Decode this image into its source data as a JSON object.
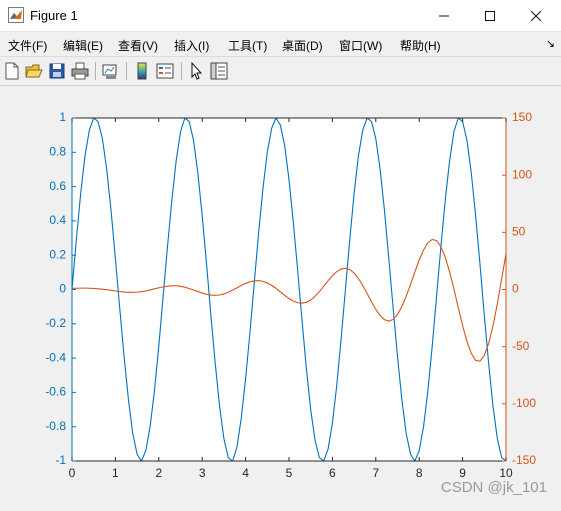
{
  "window": {
    "title": "Figure 1"
  },
  "menu": [
    "文件(F)",
    "编辑(E)",
    "查看(V)",
    "插入(I)",
    "工具(T)",
    "桌面(D)",
    "窗口(W)",
    "帮助(H)"
  ],
  "toolbar": [
    "new-figure",
    "open-file",
    "save",
    "print",
    "link-plot",
    "colorbar",
    "legend",
    "edit-plot",
    "property-inspector"
  ],
  "watermark": "CSDN @jk_101",
  "colors": {
    "left_axis": "#0072bd",
    "right_axis": "#d95319"
  },
  "chart_data": {
    "type": "line",
    "xlim": [
      0,
      10
    ],
    "xticks": [
      "0",
      "1",
      "2",
      "3",
      "4",
      "5",
      "6",
      "7",
      "8",
      "9",
      "10"
    ],
    "yyaxis": true,
    "left": {
      "ylim": [
        -1,
        1
      ],
      "yticks": [
        "-1",
        "-0.8",
        "-0.6",
        "-0.4",
        "-0.2",
        "0",
        "0.2",
        "0.4",
        "0.6",
        "0.8",
        "1"
      ],
      "series": [
        {
          "x": [
            0,
            0.1,
            0.2,
            0.3,
            0.4,
            0.5,
            0.6,
            0.7,
            0.8,
            0.9,
            1,
            1.1,
            1.2,
            1.3,
            1.4,
            1.5,
            1.6,
            1.7,
            1.8,
            1.9,
            2,
            2.1,
            2.2,
            2.3,
            2.4,
            2.5,
            2.6,
            2.7,
            2.8,
            2.9,
            3,
            3.1,
            3.2,
            3.3,
            3.4,
            3.5,
            3.6,
            3.7,
            3.8,
            3.9,
            4,
            4.1,
            4.2,
            4.3,
            4.4,
            4.5,
            4.6,
            4.7,
            4.8,
            4.9,
            5,
            5.1,
            5.2,
            5.3,
            5.4,
            5.5,
            5.6,
            5.7,
            5.8,
            5.9,
            6,
            6.1,
            6.2,
            6.3,
            6.4,
            6.5,
            6.6,
            6.7,
            6.8,
            6.9,
            7,
            7.1,
            7.2,
            7.3,
            7.4,
            7.5,
            7.6,
            7.7,
            7.8,
            7.9,
            8,
            8.1,
            8.2,
            8.3,
            8.4,
            8.5,
            8.6,
            8.7,
            8.8,
            8.9,
            9,
            9.1,
            9.2,
            9.3,
            9.4,
            9.5,
            9.6,
            9.7,
            9.8,
            9.9,
            10
          ],
          "y": [
            0,
            0.29,
            0.56,
            0.78,
            0.93,
            1,
            0.98,
            0.88,
            0.7,
            0.46,
            0.18,
            -0.11,
            -0.39,
            -0.64,
            -0.84,
            -0.96,
            -1,
            -0.94,
            -0.8,
            -0.59,
            -0.33,
            -0.04,
            0.25,
            0.52,
            0.75,
            0.92,
            1,
            0.98,
            0.87,
            0.68,
            0.43,
            0.15,
            -0.15,
            -0.43,
            -0.68,
            -0.87,
            -0.98,
            -1,
            -0.92,
            -0.75,
            -0.52,
            -0.25,
            0.04,
            0.33,
            0.59,
            0.8,
            0.94,
            1,
            0.96,
            0.84,
            0.64,
            0.39,
            0.11,
            -0.18,
            -0.46,
            -0.7,
            -0.88,
            -0.98,
            -1,
            -0.93,
            -0.78,
            -0.56,
            -0.29,
            0,
            0.29,
            0.56,
            0.78,
            0.93,
            1,
            0.98,
            0.88,
            0.7,
            0.46,
            0.18,
            -0.11,
            -0.39,
            -0.64,
            -0.84,
            -0.96,
            -1,
            -0.94,
            -0.8,
            -0.59,
            -0.33,
            -0.04,
            0.25,
            0.52,
            0.75,
            0.92,
            1,
            0.98,
            0.87,
            0.68,
            0.43,
            0.15,
            -0.15,
            -0.43,
            -0.68,
            -0.87,
            -0.98,
            -1
          ]
        }
      ]
    },
    "right": {
      "ylim": [
        -150,
        150
      ],
      "yticks": [
        "-150",
        "-100",
        "-50",
        "0",
        "50",
        "100",
        "150"
      ],
      "series": [
        {
          "x": [
            0,
            0.1,
            0.2,
            0.3,
            0.4,
            0.5,
            0.6,
            0.7,
            0.8,
            0.9,
            1,
            1.1,
            1.2,
            1.3,
            1.4,
            1.5,
            1.6,
            1.7,
            1.8,
            1.9,
            2,
            2.1,
            2.2,
            2.3,
            2.4,
            2.5,
            2.6,
            2.7,
            2.8,
            2.9,
            3,
            3.1,
            3.2,
            3.3,
            3.4,
            3.5,
            3.6,
            3.7,
            3.8,
            3.9,
            4,
            4.1,
            4.2,
            4.3,
            4.4,
            4.5,
            4.6,
            4.7,
            4.8,
            4.9,
            5,
            5.1,
            5.2,
            5.3,
            5.4,
            5.5,
            5.6,
            5.7,
            5.8,
            5.9,
            6,
            6.1,
            6.2,
            6.3,
            6.4,
            6.5,
            6.6,
            6.7,
            6.8,
            6.9,
            7,
            7.1,
            7.2,
            7.3,
            7.4,
            7.5,
            7.6,
            7.7,
            7.8,
            7.9,
            8,
            8.1,
            8.2,
            8.3,
            8.4,
            8.5,
            8.6,
            8.7,
            8.8,
            8.9,
            9,
            9.1,
            9.2,
            9.3,
            9.4,
            9.5,
            9.6,
            9.7,
            9.8,
            9.9,
            10
          ],
          "y": [
            1,
            1.1,
            1.2,
            1.2,
            1.1,
            0.9,
            0.6,
            0.3,
            -0.2,
            -0.7,
            -1.3,
            -1.8,
            -2.2,
            -2.5,
            -2.5,
            -2.3,
            -1.9,
            -1.2,
            -0.4,
            0.6,
            1.5,
            2.3,
            2.9,
            3.2,
            3.2,
            2.8,
            2.0,
            0.9,
            -0.4,
            -1.8,
            -3.1,
            -4.2,
            -4.9,
            -5.1,
            -4.8,
            -3.9,
            -2.4,
            -0.6,
            1.4,
            3.5,
            5.3,
            6.8,
            7.6,
            7.8,
            7.1,
            5.7,
            3.6,
            1.0,
            -2.0,
            -5.1,
            -7.9,
            -10.2,
            -11.6,
            -12.0,
            -11.2,
            -9.2,
            -6.0,
            -1.9,
            2.8,
            7.6,
            12.0,
            15.6,
            17.9,
            18.6,
            17.5,
            14.4,
            9.6,
            3.5,
            -3.5,
            -10.7,
            -17.4,
            -22.9,
            -26.4,
            -27.7,
            -26.2,
            -21.9,
            -15.0,
            -6.0,
            4.5,
            15.4,
            25.8,
            34.6,
            40.9,
            43.8,
            42.8,
            37.5,
            28.2,
            15.5,
            0.4,
            -15.8,
            -31.6,
            -45.4,
            -55.9,
            -62.0,
            -62.7,
            -57.7,
            -47.2,
            -31.8,
            -12.5,
            9.2,
            31.3
          ]
        }
      ]
    }
  }
}
